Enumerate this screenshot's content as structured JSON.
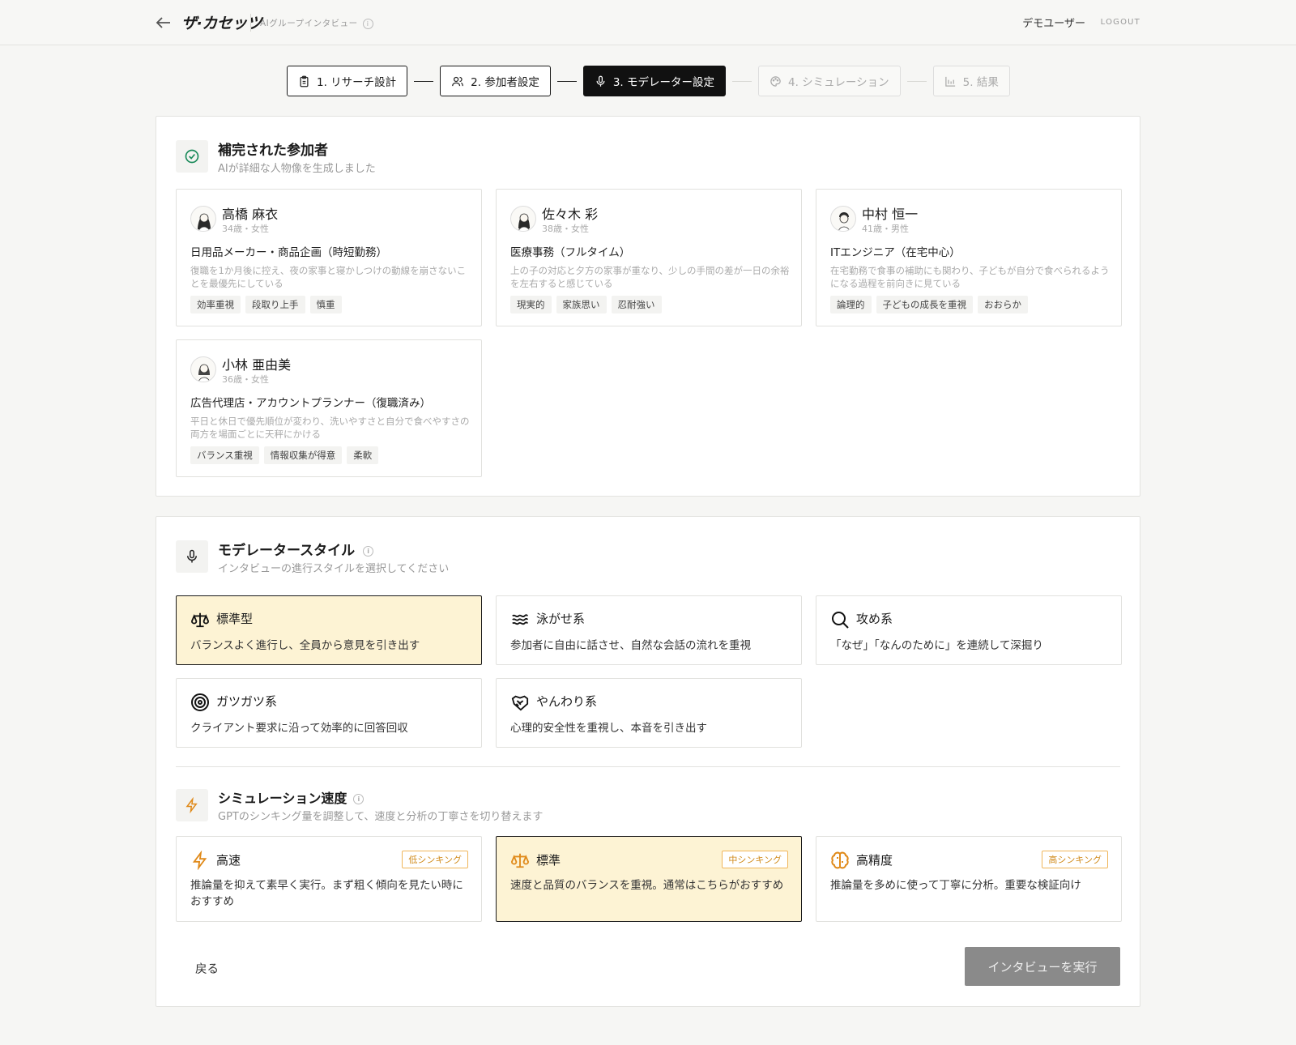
{
  "header": {
    "logo": "ザ·カセッツ",
    "breadcrumb": "AIグループインタビュー",
    "info_glyph": "i",
    "user_name": "デモユーザー",
    "logout": "LOGOUT"
  },
  "stepper": {
    "steps": [
      {
        "label": "1. リサーチ設計",
        "icon": "clipboard-icon",
        "state": "done"
      },
      {
        "label": "2. 参加者設定",
        "icon": "users-icon",
        "state": "done"
      },
      {
        "label": "3. モデレーター設定",
        "icon": "mic-icon",
        "state": "active"
      },
      {
        "label": "4. シミュレーション",
        "icon": "palette-icon",
        "state": "disabled"
      },
      {
        "label": "5. 結果",
        "icon": "chart-icon",
        "state": "disabled"
      }
    ]
  },
  "participants_section": {
    "title": "補完された参加者",
    "subtitle": "AIが詳細な人物像を生成しました",
    "icon": "check-circle-icon",
    "cards": [
      {
        "name": "高橋 麻衣",
        "meta": "34歳・女性",
        "role": "日用品メーカー・商品企画（時短勤務）",
        "desc": "復職を1か月後に控え、夜の家事と寝かしつけの動線を崩さないことを最優先にしている",
        "tags": [
          "効率重視",
          "段取り上手",
          "慎重"
        ]
      },
      {
        "name": "佐々木 彩",
        "meta": "38歳・女性",
        "role": "医療事務（フルタイム）",
        "desc": "上の子の対応と夕方の家事が重なり、少しの手間の差が一日の余裕を左右すると感じている",
        "tags": [
          "現実的",
          "家族思い",
          "忍耐強い"
        ]
      },
      {
        "name": "中村 恒一",
        "meta": "41歳・男性",
        "role": "ITエンジニア（在宅中心）",
        "desc": "在宅勤務で食事の補助にも関わり、子どもが自分で食べられるようになる過程を前向きに見ている",
        "tags": [
          "論理的",
          "子どもの成長を重視",
          "おおらか"
        ]
      },
      {
        "name": "小林 亜由美",
        "meta": "36歳・女性",
        "role": "広告代理店・アカウントプランナー（復職済み）",
        "desc": "平日と休日で優先順位が変わり、洗いやすさと自分で食べやすさの両方を場面ごとに天秤にかける",
        "tags": [
          "バランス重視",
          "情報収集が得意",
          "柔軟"
        ]
      }
    ]
  },
  "moderator_section": {
    "title": "モデレータースタイル",
    "subtitle": "インタビューの進行スタイルを選択してください",
    "styles": [
      {
        "title": "標準型",
        "desc": "バランスよく進行し、全員から意見を引き出す",
        "icon": "scale-icon",
        "selected": true
      },
      {
        "title": "泳がせ系",
        "desc": "参加者に自由に話させ、自然な会話の流れを重視",
        "icon": "waves-icon",
        "selected": false
      },
      {
        "title": "攻め系",
        "desc": "「なぜ」「なんのために」を連続して深掘り",
        "icon": "search-icon",
        "selected": false
      },
      {
        "title": "ガツガツ系",
        "desc": "クライアント要求に沿って効率的に回答回収",
        "icon": "target-icon",
        "selected": false
      },
      {
        "title": "やんわり系",
        "desc": "心理的安全性を重視し、本音を引き出す",
        "icon": "handshake-icon",
        "selected": false
      }
    ]
  },
  "speed_section": {
    "title": "シミュレーション速度",
    "subtitle": "GPTのシンキング量を調整して、速度と分析の丁寧さを切り替えます",
    "options": [
      {
        "title": "高速",
        "badge": "低シンキング",
        "desc": "推論量を抑えて素早く実行。まず粗く傾向を見たい時におすすめ",
        "icon": "bolt-icon",
        "selected": false
      },
      {
        "title": "標準",
        "badge": "中シンキング",
        "desc": "速度と品質のバランスを重視。通常はこちらがおすすめ",
        "icon": "scale-icon",
        "selected": true
      },
      {
        "title": "高精度",
        "badge": "高シンキング",
        "desc": "推論量を多めに使って丁寧に分析。重要な検証向け",
        "icon": "brain-icon",
        "selected": false
      }
    ]
  },
  "footer": {
    "back_label": "戻る",
    "run_label": "インタビューを実行"
  },
  "colors": {
    "accent_selected_bg": "#fdf3d4",
    "badge_orange": "#d08a1a",
    "check_green": "#1a8a5a",
    "run_button_disabled": "#8a8a8a"
  }
}
